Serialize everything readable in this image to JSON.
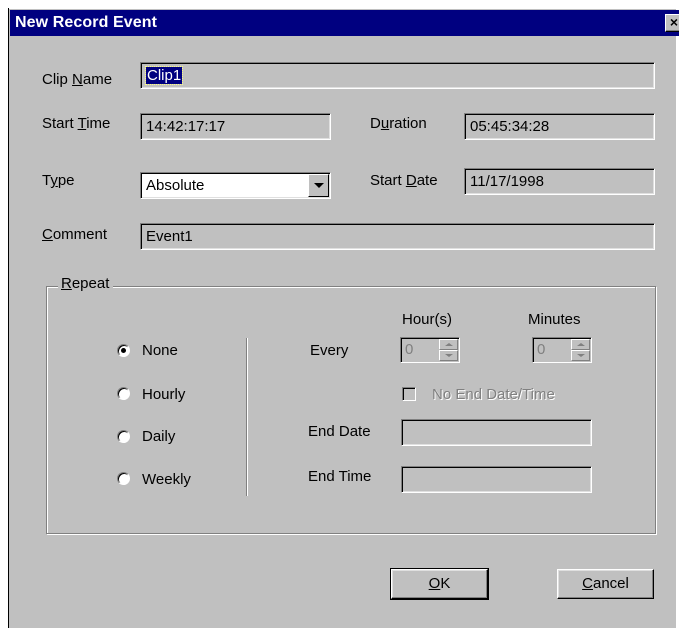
{
  "window": {
    "title": "New Record Event",
    "close_glyph": "×"
  },
  "form": {
    "clip_name": {
      "label_pre": "Clip ",
      "label_key": "N",
      "label_post": "ame",
      "value": "Clip1"
    },
    "start_time": {
      "label_pre": "Start ",
      "label_key": "T",
      "label_post": "ime",
      "value": "14:42:17:17"
    },
    "duration": {
      "label_pre": "D",
      "label_key": "u",
      "label_post": "ration",
      "value": "05:45:34:28"
    },
    "type": {
      "label_pre": "T",
      "label_key": "y",
      "label_post": "pe",
      "value": "Absolute"
    },
    "start_date": {
      "label_pre": "Start ",
      "label_key": "D",
      "label_post": "ate",
      "value": "11/17/1998"
    },
    "comment": {
      "label_pre": "",
      "label_key": "C",
      "label_post": "omment",
      "value": "Event1"
    }
  },
  "repeat": {
    "caption_key": "R",
    "caption_post": "epeat",
    "options": [
      {
        "label": "None",
        "checked": true
      },
      {
        "label": "Hourly",
        "checked": false
      },
      {
        "label": "Daily",
        "checked": false
      },
      {
        "label": "Weekly",
        "checked": false
      }
    ],
    "every_label": "Every",
    "hours_label": "Hour(s)",
    "minutes_label": "Minutes",
    "hours_value": "0",
    "minutes_value": "0",
    "no_end_label": "No End Date/Time",
    "end_date_label": "End Date",
    "end_date_value": "",
    "end_time_label": "End Time",
    "end_time_value": ""
  },
  "buttons": {
    "ok_key": "O",
    "ok_post": "K",
    "cancel_key": "C",
    "cancel_post": "ancel"
  },
  "colors": {
    "titlebar": "#000080",
    "face": "#c0c0c0",
    "selection": "#000080"
  }
}
